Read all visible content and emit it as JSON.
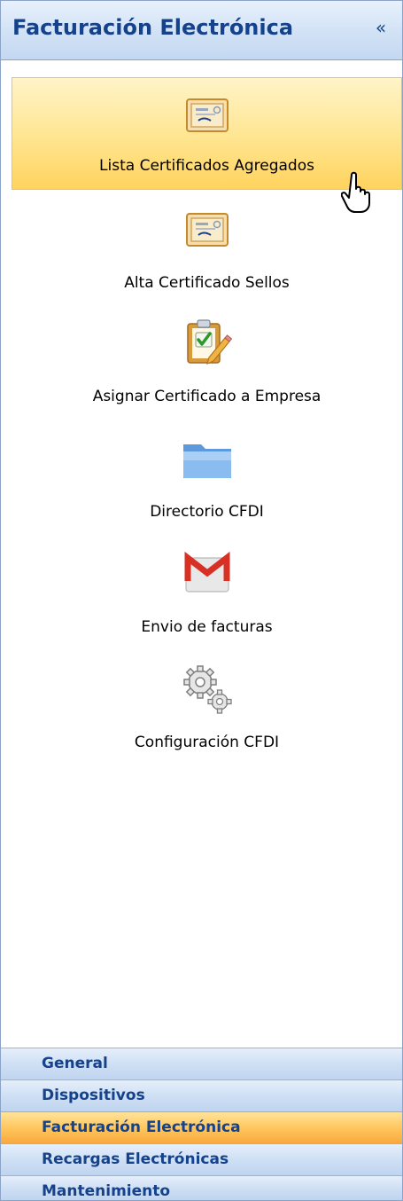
{
  "header": {
    "title": "Facturación Electrónica",
    "collapse_icon": "«"
  },
  "items": [
    {
      "label": "Lista Certificados Agregados",
      "icon": "certificate-icon",
      "selected": true
    },
    {
      "label": "Alta Certificado Sellos",
      "icon": "certificate-icon"
    },
    {
      "label": "Asignar Certificado a Empresa",
      "icon": "clipboard-check-icon"
    },
    {
      "label": "Directorio CFDI",
      "icon": "folder-icon"
    },
    {
      "label": "Envio de facturas",
      "icon": "gmail-icon"
    },
    {
      "label": "Configuración CFDI",
      "icon": "gears-icon"
    }
  ],
  "nav": [
    {
      "label": "General"
    },
    {
      "label": "Dispositivos"
    },
    {
      "label": "Facturación Electrónica",
      "active": true
    },
    {
      "label": "Recargas Electrónicas"
    },
    {
      "label": "Mantenimiento"
    }
  ],
  "colors": {
    "header_text": "#15428b",
    "selected_item": "#ffe590",
    "active_nav": "#ffc75e"
  }
}
